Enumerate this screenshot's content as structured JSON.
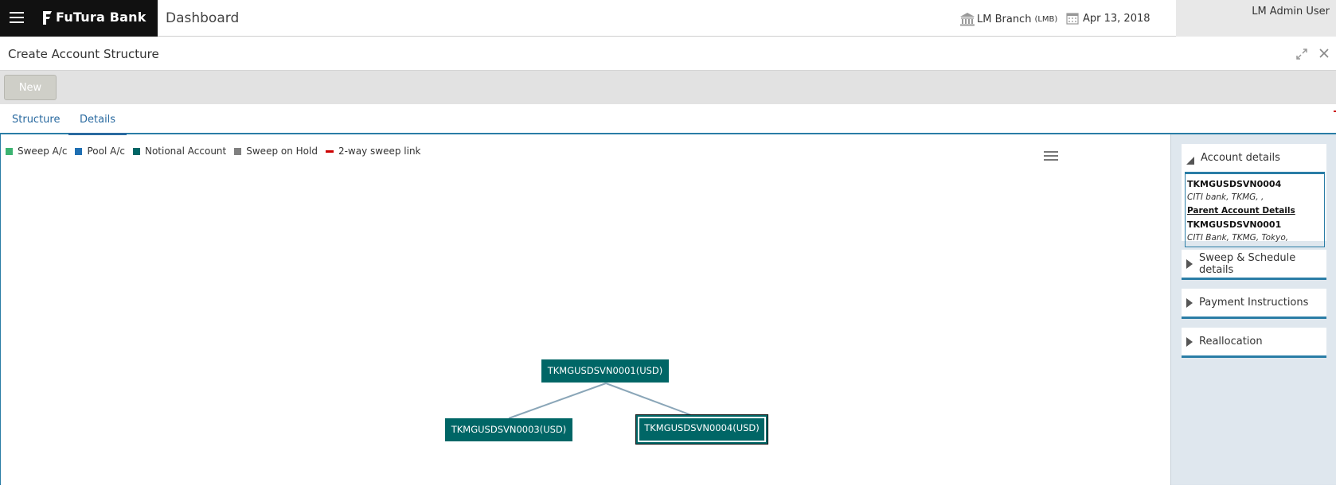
{
  "header": {
    "brand": "FuTura Bank",
    "title": "Dashboard",
    "branch": "LM Branch",
    "branch_code": "(LMB)",
    "date": "Apr 13, 2018",
    "user": "LM Admin User"
  },
  "subheader": {
    "title": "Create Account Structure"
  },
  "toolbar": {
    "new_label": "New"
  },
  "tabs": [
    {
      "label": "Structure",
      "active": false
    },
    {
      "label": "Details",
      "active": true
    }
  ],
  "legend": [
    {
      "label": "Sweep A/c",
      "color": "#3cb371"
    },
    {
      "label": "Pool A/c",
      "color": "#1f6fb2"
    },
    {
      "label": "Notional Account",
      "color": "#006666"
    },
    {
      "label": "Sweep on Hold",
      "color": "#808080"
    },
    {
      "label": "2-way sweep link",
      "color": "#cc0000"
    }
  ],
  "tree": {
    "root": "TKMGUSDSVN0001(USD)",
    "children": [
      {
        "label": "TKMGUSDSVN0003(USD)",
        "selected": false
      },
      {
        "label": "TKMGUSDSVN0004(USD)",
        "selected": true
      }
    ],
    "node_color": "#006666",
    "link_color": "#8aa6b8"
  },
  "side": {
    "account_details": {
      "title": "Account details",
      "account": "TKMGUSDSVN0004",
      "account_info": "CITI bank, TKMG, ,",
      "parent_label": "Parent Account Details",
      "parent_account": "TKMGUSDSVN0001",
      "parent_info": "CITI Bank, TKMG, Tokyo,"
    },
    "panels": [
      {
        "title": "Sweep & Schedule details"
      },
      {
        "title": "Payment Instructions"
      },
      {
        "title": "Reallocation"
      }
    ]
  },
  "colors": {
    "accent": "#2a7da6",
    "brand_bg": "#111111",
    "node": "#006666"
  }
}
